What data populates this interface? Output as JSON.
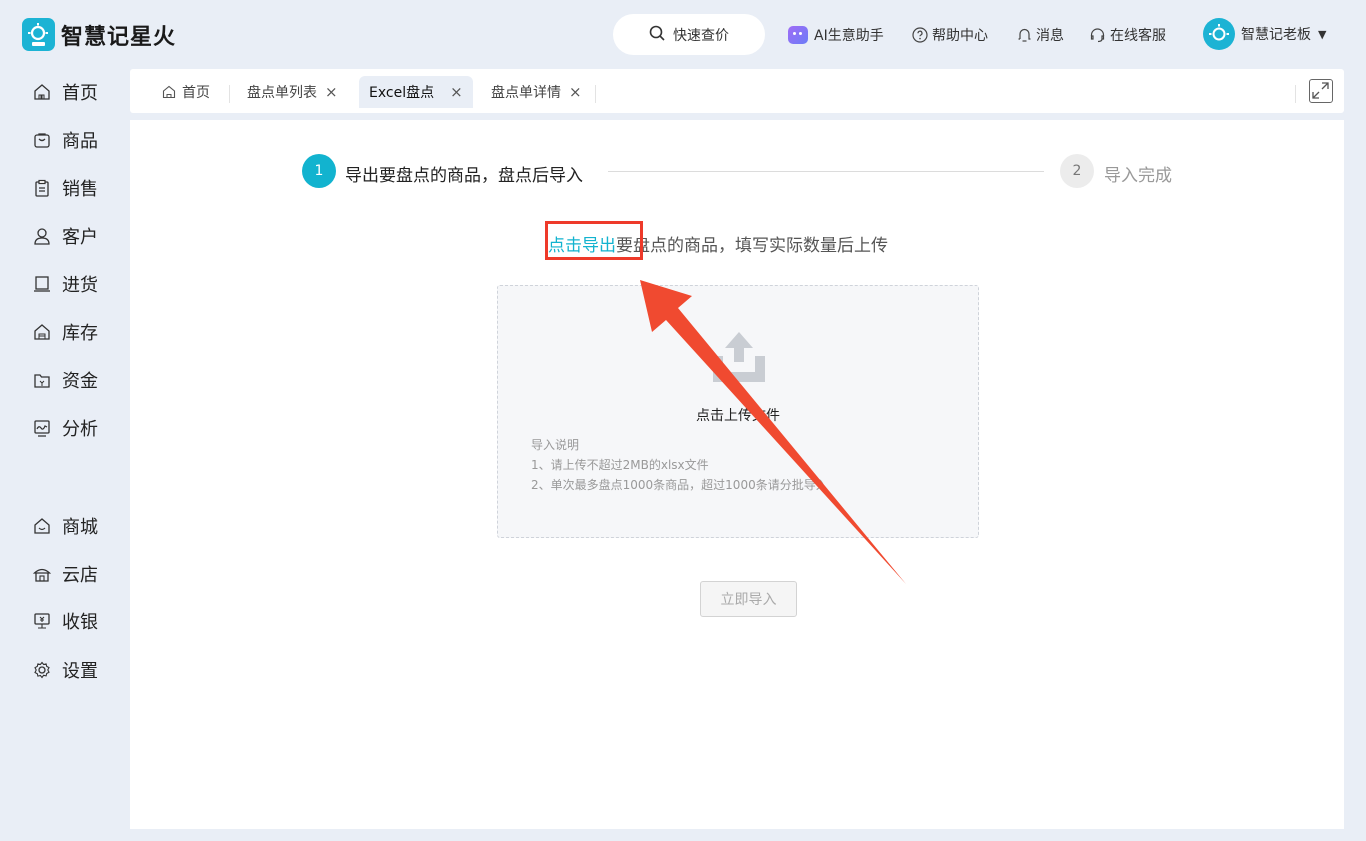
{
  "app": {
    "name": "智慧记星火"
  },
  "header": {
    "search_label": "快速查价",
    "ai_label": "AI生意助手",
    "help_label": "帮助中心",
    "messages_label": "消息",
    "service_label": "在线客服",
    "user_name": "智慧记老板"
  },
  "sidebar": {
    "items": [
      {
        "label": "首页",
        "icon": "home-icon"
      },
      {
        "label": "商品",
        "icon": "bag-icon"
      },
      {
        "label": "销售",
        "icon": "clipboard-icon"
      },
      {
        "label": "客户",
        "icon": "user-icon"
      },
      {
        "label": "进货",
        "icon": "box-icon"
      },
      {
        "label": "库存",
        "icon": "warehouse-icon"
      },
      {
        "label": "资金",
        "icon": "wallet-icon"
      },
      {
        "label": "分析",
        "icon": "chart-icon"
      },
      {
        "label": "商城",
        "icon": "shop-icon"
      },
      {
        "label": "云店",
        "icon": "store-icon"
      },
      {
        "label": "收银",
        "icon": "cashier-icon"
      },
      {
        "label": "设置",
        "icon": "gear-icon"
      }
    ]
  },
  "tabs": [
    {
      "label": "首页"
    },
    {
      "label": "盘点单列表"
    },
    {
      "label": "Excel盘点"
    },
    {
      "label": "盘点单详情"
    }
  ],
  "steps": [
    {
      "number": "1",
      "label": "导出要盘点的商品，盘点后导入"
    },
    {
      "number": "2",
      "label": "导入完成"
    }
  ],
  "instruction": {
    "link": "点击导出",
    "text": "要盘点的商品，填写实际数量后上传"
  },
  "upload": {
    "title": "点击上传文件",
    "notes_title": "导入说明",
    "note1": "1、请上传不超过2MB的xlsx文件",
    "note2": "2、单次最多盘点1000条商品，超过1000条请分批导入"
  },
  "import_button": "立即导入",
  "colors": {
    "accent": "#12b3cf",
    "annotation": "#ee3a2a",
    "background": "#e9eef6"
  }
}
